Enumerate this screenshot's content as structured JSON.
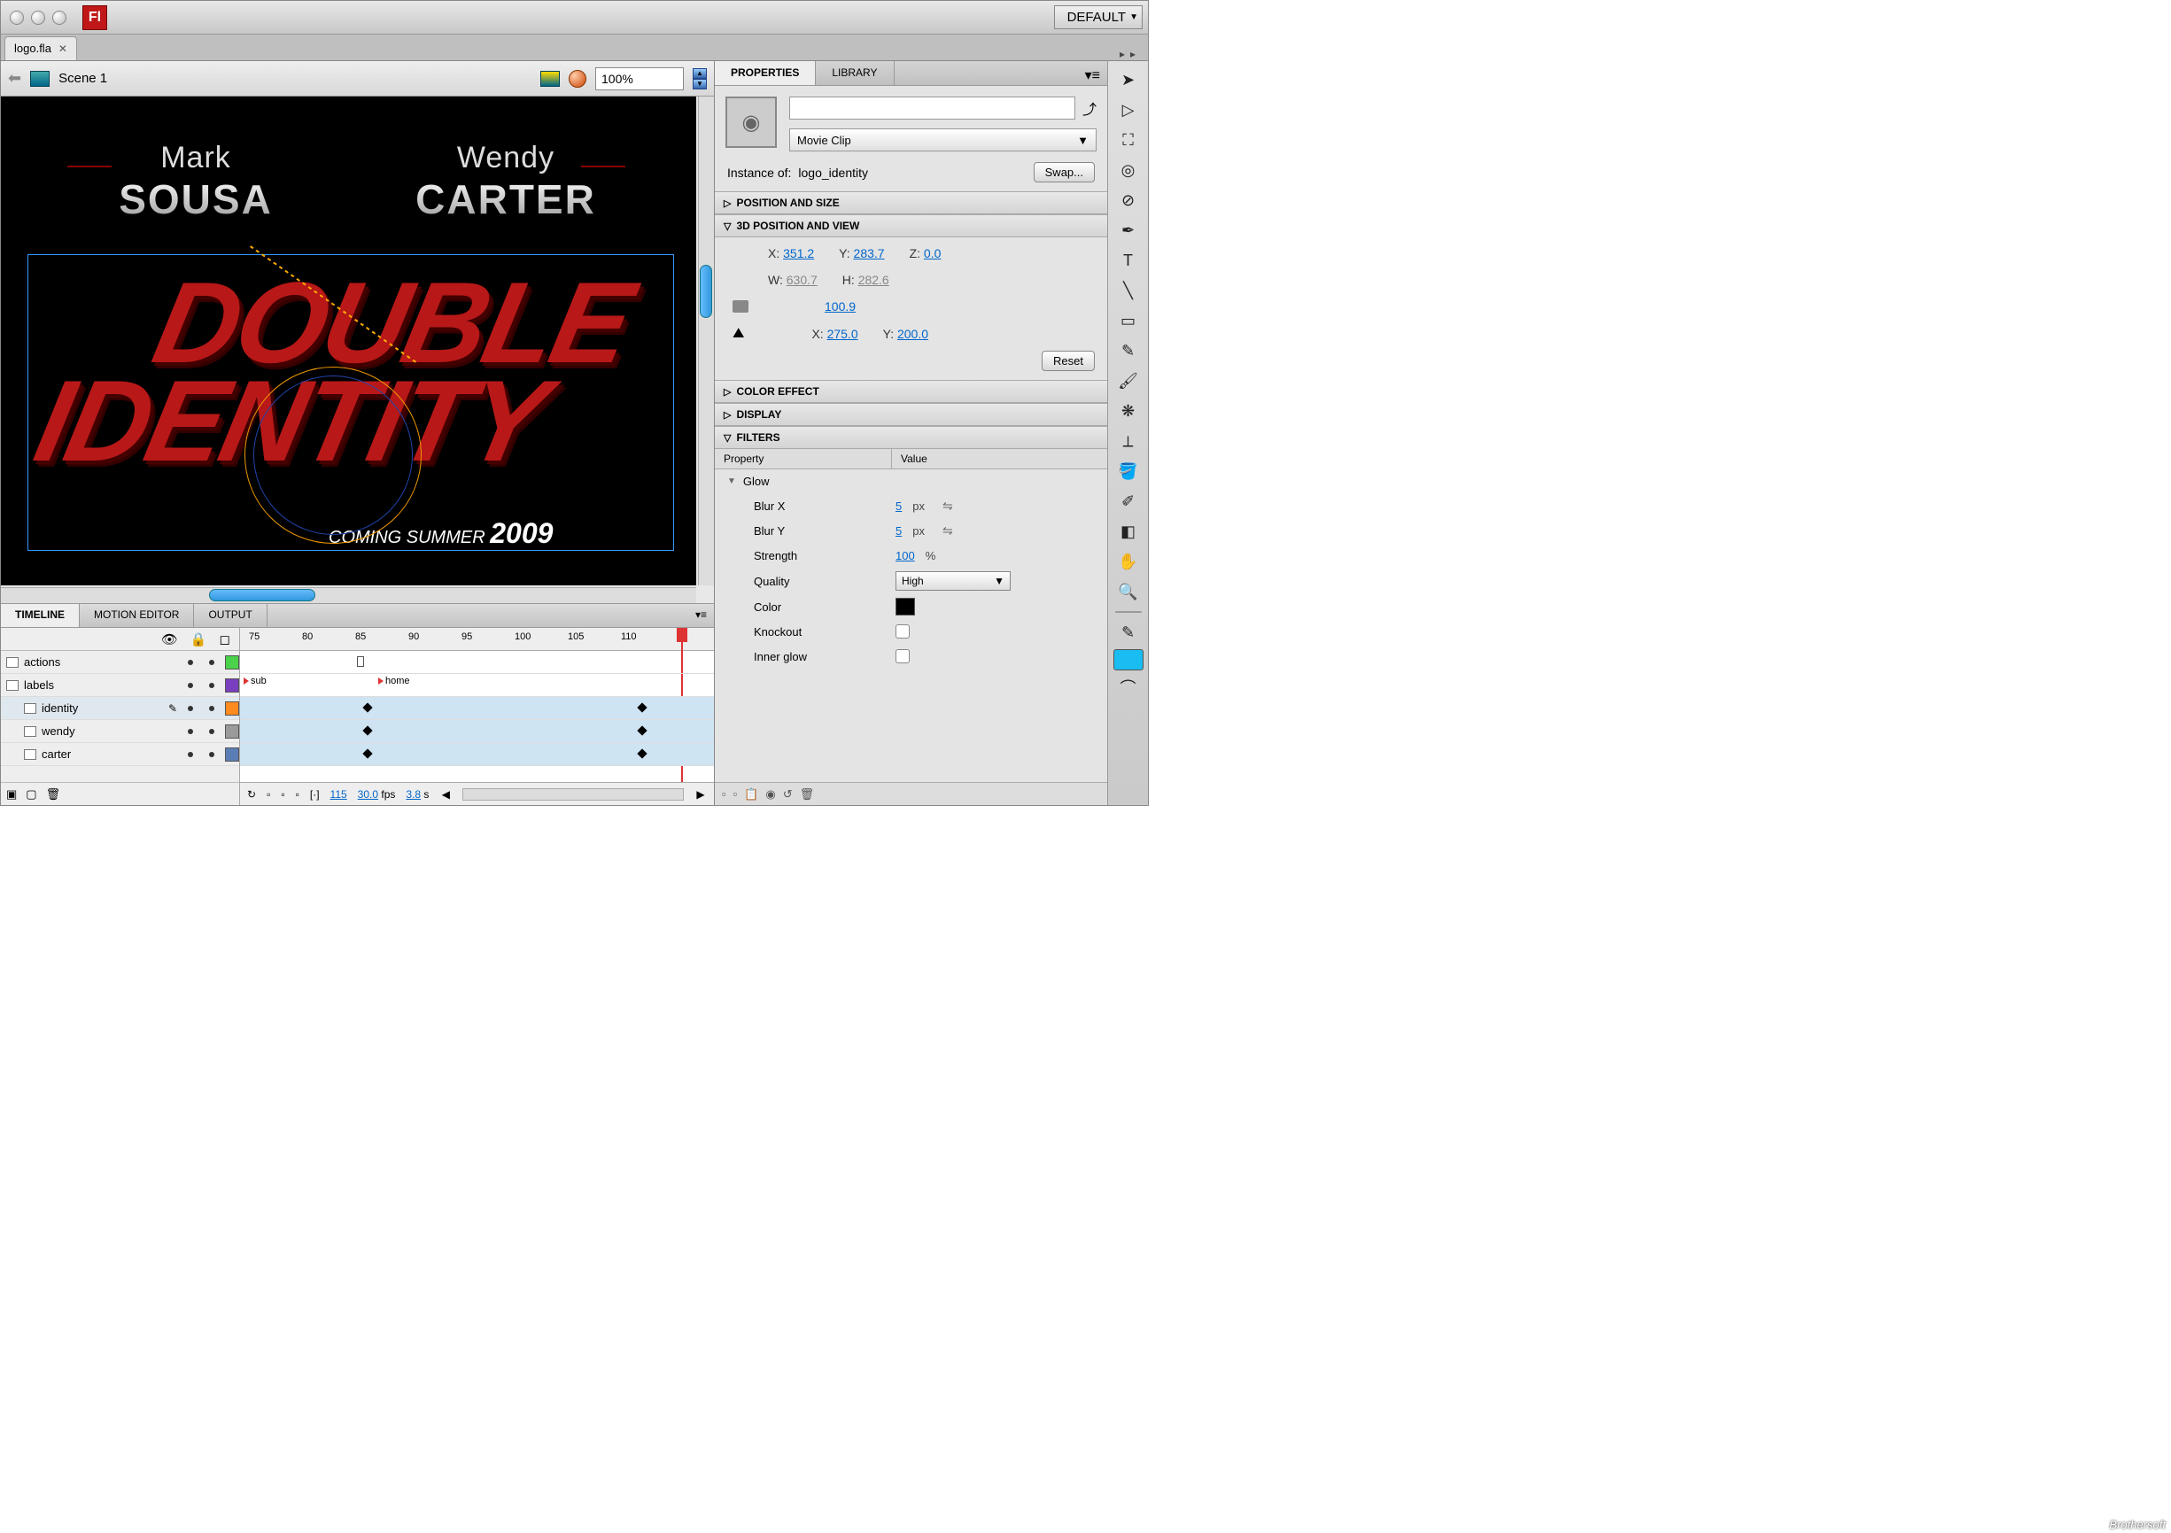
{
  "titlebar": {
    "workspace": "DEFAULT"
  },
  "document": {
    "tab_name": "logo.fla"
  },
  "edit_bar": {
    "scene": "Scene 1",
    "zoom": "100%"
  },
  "stage": {
    "credit1_first": "Mark",
    "credit1_last": "SOUSA",
    "credit2_first": "Wendy",
    "credit2_last": "CARTER",
    "title_line1": "DOUBLE",
    "title_line2": "IDENTITY",
    "tag_prefix": "COMING SUMMER",
    "tag_year": "2009"
  },
  "timeline": {
    "tabs": [
      "TIMELINE",
      "MOTION EDITOR",
      "OUTPUT"
    ],
    "ruler": [
      "75",
      "80",
      "85",
      "90",
      "95",
      "100",
      "105",
      "110",
      "1"
    ],
    "layers": [
      {
        "name": "actions",
        "indent": false,
        "sel": false,
        "color": "#4bd24b"
      },
      {
        "name": "labels",
        "indent": false,
        "sel": false,
        "color": "#7a3fbf"
      },
      {
        "name": "identity",
        "indent": true,
        "sel": true,
        "color": "#ff8a1f"
      },
      {
        "name": "wendy",
        "indent": true,
        "sel": false,
        "color": "#9a9a9a"
      },
      {
        "name": "carter",
        "indent": true,
        "sel": false,
        "color": "#5b7db6"
      }
    ],
    "labels_track": {
      "sub": "sub",
      "home": "home"
    },
    "status": {
      "frame": "115",
      "fps": "30.0",
      "fps_unit": "fps",
      "time": "3.8",
      "time_unit": "s"
    }
  },
  "properties": {
    "tabs": [
      "PROPERTIES",
      "LIBRARY"
    ],
    "instance_type": "Movie Clip",
    "instance_of_lbl": "Instance of:",
    "instance_name": "logo_identity",
    "swap_btn": "Swap...",
    "sections": {
      "pos_size": "POSITION AND SIZE",
      "pos3d": "3D POSITION AND VIEW",
      "color": "COLOR EFFECT",
      "display": "DISPLAY",
      "filters": "FILTERS"
    },
    "pos3d": {
      "x_lbl": "X:",
      "x": "351.2",
      "y_lbl": "Y:",
      "y": "283.7",
      "z_lbl": "Z:",
      "z": "0.0",
      "w_lbl": "W:",
      "w": "630.7",
      "h_lbl": "H:",
      "h": "282.6",
      "persp": "100.9",
      "vx_lbl": "X:",
      "vx": "275.0",
      "vy_lbl": "Y:",
      "vy": "200.0",
      "reset": "Reset"
    },
    "filters": {
      "head_prop": "Property",
      "head_val": "Value",
      "group": "Glow",
      "rows": {
        "blurx": {
          "name": "Blur X",
          "val": "5",
          "unit": "px"
        },
        "blury": {
          "name": "Blur Y",
          "val": "5",
          "unit": "px"
        },
        "strength": {
          "name": "Strength",
          "val": "100",
          "unit": "%"
        },
        "quality": {
          "name": "Quality",
          "val": "High"
        },
        "color": {
          "name": "Color",
          "val": "#000000"
        },
        "knockout": {
          "name": "Knockout"
        },
        "inner": {
          "name": "Inner glow"
        }
      }
    }
  },
  "watermark": "Brothersoft"
}
